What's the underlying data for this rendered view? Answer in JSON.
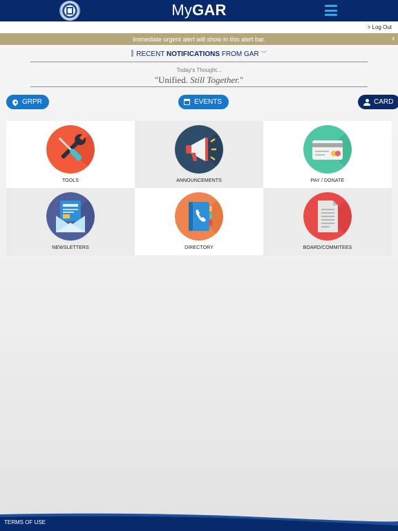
{
  "header": {
    "title_light": "My",
    "title_bold": "GAR",
    "brand_color": "#062a6b",
    "accent_color": "#38a7e8"
  },
  "account": {
    "logout_label": "> Log Out"
  },
  "alert": {
    "text": "Immediate urgent alert will show in this alert bar.",
    "chevron": "›",
    "color": "#b6a77a"
  },
  "notifications": {
    "prefix": "RECENT",
    "bold": "NOTIFICATIONS",
    "suffix": "FROM GAR",
    "caret": "﹀"
  },
  "thought": {
    "label": "Today's Thought...",
    "quote_open": "\"Unified.",
    "quote_emphasis": "Still Together.",
    "quote_close": "\""
  },
  "quick_links": {
    "grpr": "GRPR",
    "events": "EVENTS",
    "card": "CARD"
  },
  "tiles": [
    {
      "label": "TOOLS",
      "icon": "tools-icon",
      "color": "#f15a3a"
    },
    {
      "label": "ANNOUNCEMENTS",
      "icon": "megaphone-icon",
      "color": "#2e4d6b"
    },
    {
      "label": "PAY / DONATE",
      "icon": "credit-card-icon",
      "color": "#4fc7a4"
    },
    {
      "label": "NEWSLETTERS",
      "icon": "newsletter-icon",
      "color": "#4e5f99"
    },
    {
      "label": "DIRECTORY",
      "icon": "phone-book-icon",
      "color": "#f0844f"
    },
    {
      "label": "BOARD/COMMITEES",
      "icon": "document-icon",
      "color": "#e84a4a"
    }
  ],
  "footer": {
    "terms_label": "TERMS OF USE"
  }
}
